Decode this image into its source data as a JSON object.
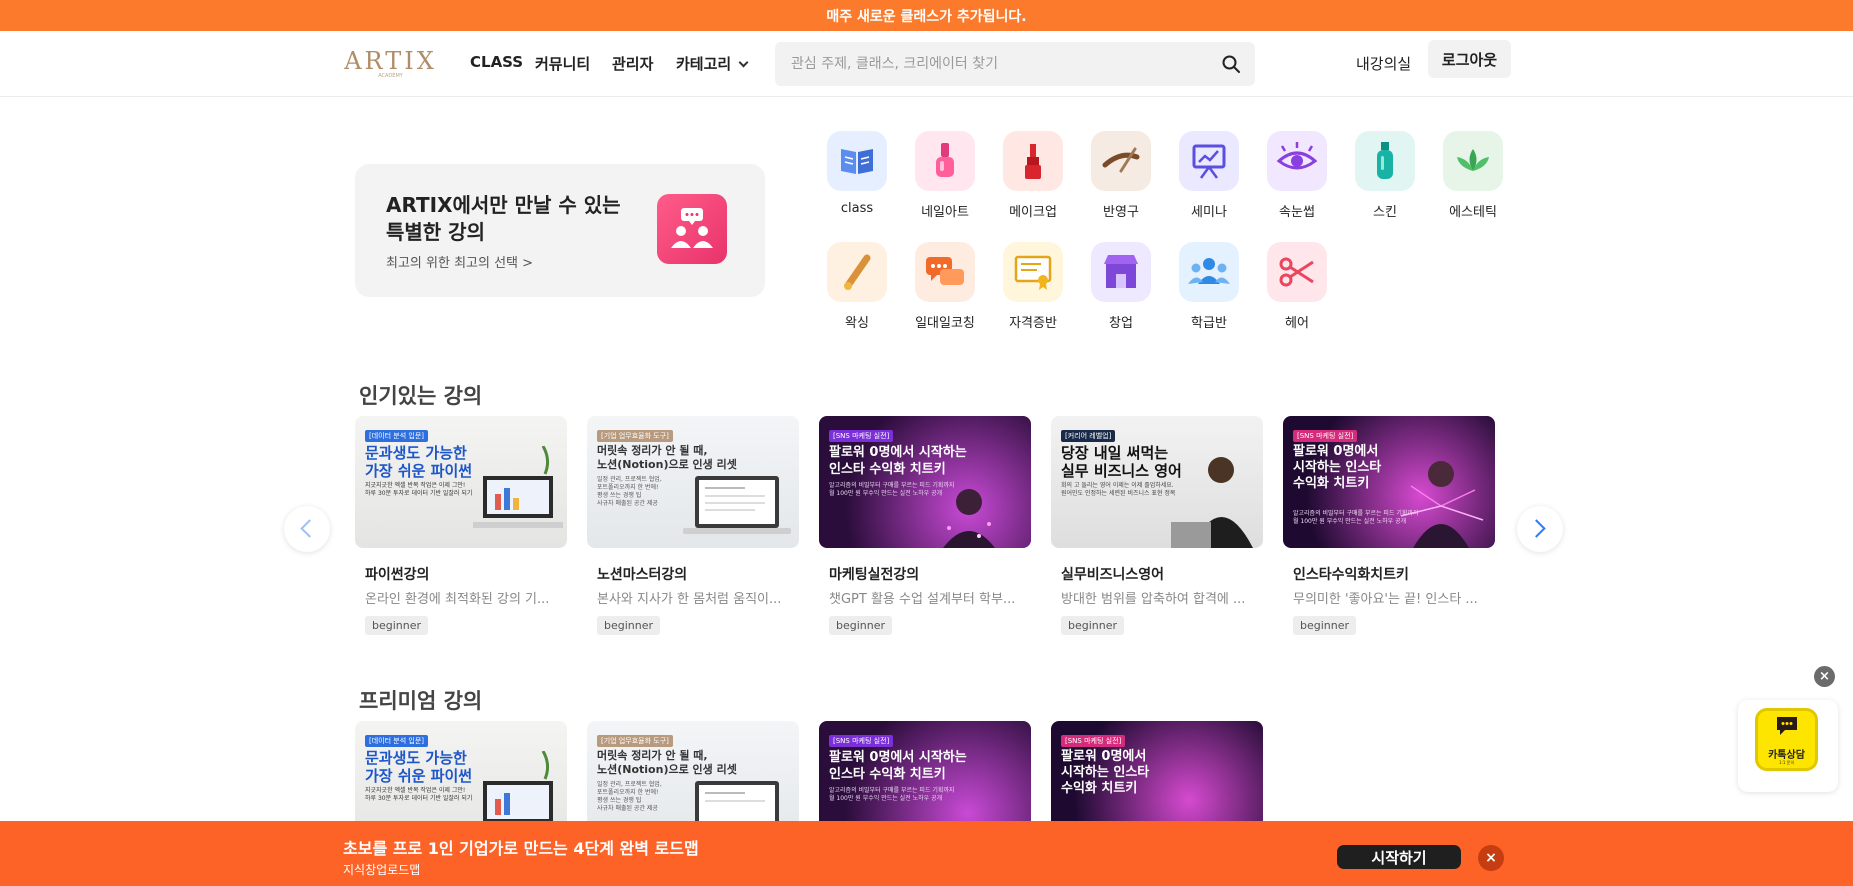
{
  "announcement": "매주 새로운 클래스가 추가됩니다.",
  "header": {
    "logo": "ARTIX",
    "logo_sub": "ACADEMY",
    "nav": [
      "CLASS",
      "커뮤니티",
      "관리자",
      "카테고리"
    ],
    "search_placeholder": "관심 주제, 클래스, 크리에이터 찾기",
    "my_class": "내강의실",
    "logout": "로그아웃"
  },
  "promo": {
    "title_line1": "ARTIX에서만 만날 수 있는",
    "title_line2": "특별한 강의",
    "subtitle": "최고의 위한 최고의 선택 >"
  },
  "categories": [
    {
      "label": "class",
      "icon": "book-icon",
      "bg": "#e6efff"
    },
    {
      "label": "네일아트",
      "icon": "nail-polish-icon",
      "bg": "#ffe6ef"
    },
    {
      "label": "메이크업",
      "icon": "lipstick-icon",
      "bg": "#ffe7e3"
    },
    {
      "label": "반영구",
      "icon": "eyebrow-icon",
      "bg": "#f5ebe2"
    },
    {
      "label": "세미나",
      "icon": "presentation-icon",
      "bg": "#ebe9ff"
    },
    {
      "label": "속눈썹",
      "icon": "eye-icon",
      "bg": "#f1e8ff"
    },
    {
      "label": "스킨",
      "icon": "skincare-bottle-icon",
      "bg": "#e1f5f2"
    },
    {
      "label": "에스테틱",
      "icon": "lotus-icon",
      "bg": "#e6f5e8"
    },
    {
      "label": "왁싱",
      "icon": "wax-spatula-icon",
      "bg": "#fff1e1"
    },
    {
      "label": "일대일코칭",
      "icon": "chat-bubbles-icon",
      "bg": "#ffece1"
    },
    {
      "label": "자격증반",
      "icon": "certificate-icon",
      "bg": "#fff6dc"
    },
    {
      "label": "창업",
      "icon": "shop-icon",
      "bg": "#efe9ff"
    },
    {
      "label": "학급반",
      "icon": "group-icon",
      "bg": "#e4f2ff"
    },
    {
      "label": "헤어",
      "icon": "scissors-icon",
      "bg": "#ffe6eb"
    }
  ],
  "sections": {
    "popular_title": "인기있는 강의",
    "premium_title": "프리미엄 강의"
  },
  "popular_courses": [
    {
      "title": "파이썬강의",
      "desc": "온라인 환경에 최적화된 강의 기...",
      "badge": "beginner",
      "thumb_tag": "[데이터 분석 입문]",
      "thumb_title": "문과생도 가능한\n가장 쉬운 파이썬",
      "thumb_sub": "지긋지긋한 엑셀 반복 작업은 이제 그만!\n하루 30분 투자로 데이터 기반 일잘러 되기"
    },
    {
      "title": "노션마스터강의",
      "desc": "본사와 지사가 한 몸처럼 움직이...",
      "badge": "beginner",
      "thumb_tag": "[기업 업무효율화 도구]",
      "thumb_title": "머릿속 정리가 안 될 때,\n노션(Notion)으로 인생 리셋",
      "thumb_sub": "일정 관리, 프로젝트 협업,\n포트폴리오까지 한 번에!\n평생 쓰는 경쟁 팁\n사규차 매출된 공간 제공"
    },
    {
      "title": "마케팅실전강의",
      "desc": "챗GPT 활용 수업 설계부터 학부...",
      "badge": "beginner",
      "thumb_tag": "[SNS 마케팅 실전]",
      "thumb_title": "팔로워 0명에서 시작하는\n인스타 수익화 치트키",
      "thumb_sub": "알고리즘의 비밀부터 구매를 부르는 피드 기획까지\n월 100만 원 부수익 만드는 실전 노하우 공개"
    },
    {
      "title": "실무비즈니스영어",
      "desc": "방대한 범위를 압축하여 합격에 ...",
      "badge": "beginner",
      "thumb_tag": "[커리어 레벨업]",
      "thumb_title": "당장 내일 써먹는\n실무 비즈니스 영어",
      "thumb_sub": "회의 고 들리는 영어 이제는 이제 졸업하세요.\n원어민도 인정하는 세련된 비즈니스 표현 정복"
    },
    {
      "title": "인스타수익화치트키",
      "desc": "무의미한 '좋아요'는 끝! 인스타 ...",
      "badge": "beginner",
      "thumb_tag": "[SNS 마케팅 실전]",
      "thumb_title": "팔로워 0명에서\n시작하는 인스타\n수익화 치트키",
      "thumb_sub": "알고리즘의 비밀부터 구매를 부르는 피드 기획까지\n월 100만 원 부수익 만드는 실전 노하우 공개"
    }
  ],
  "premium_courses": [
    {
      "thumb_tag": "[데이터 분석 입문]",
      "thumb_title": "문과생도 가능한\n가장 쉬운 파이썬",
      "thumb_sub": "지긋지긋한 엑셀 반복 작업은 이제 그만!\n하루 30분 투자로 데이터 기반 일잘러 되기"
    },
    {
      "thumb_tag": "[기업 업무효율화 도구]",
      "thumb_title": "머릿속 정리가 안 될 때,\n노션(Notion)으로 인생 리셋",
      "thumb_sub": "일정 관리, 프로젝트 협업,\n포트폴리오까지 한 번에!\n평생 쓰는 경쟁 팁\n사규차 매출된 공간 제공"
    },
    {
      "thumb_tag": "[SNS 마케팅 실전]",
      "thumb_title": "팔로워 0명에서 시작하는\n인스타 수익화 치트키",
      "thumb_sub": "알고리즘의 비밀부터 구매를 부르는 피드 기획까지\n월 100만 원 부수익 만드는 실전 노하우 공개"
    },
    {
      "thumb_tag": "[SNS 마케팅 실전]",
      "thumb_title": "팔로워 0명에서\n시작하는 인스타\n수익화 치트키",
      "thumb_sub": ""
    }
  ],
  "kakao": {
    "label": "카톡상담",
    "sub": "1:1 문의"
  },
  "bottom_banner": {
    "title": "초보를 프로 1인 기업가로 만드는 4단계 완벽 로드맵",
    "subtitle": "지식창업로드맵",
    "button": "시작하기"
  },
  "colors": {
    "accent": "#fb7a2b",
    "banner": "#fd6227",
    "link_arrow": "#2b7cff"
  }
}
